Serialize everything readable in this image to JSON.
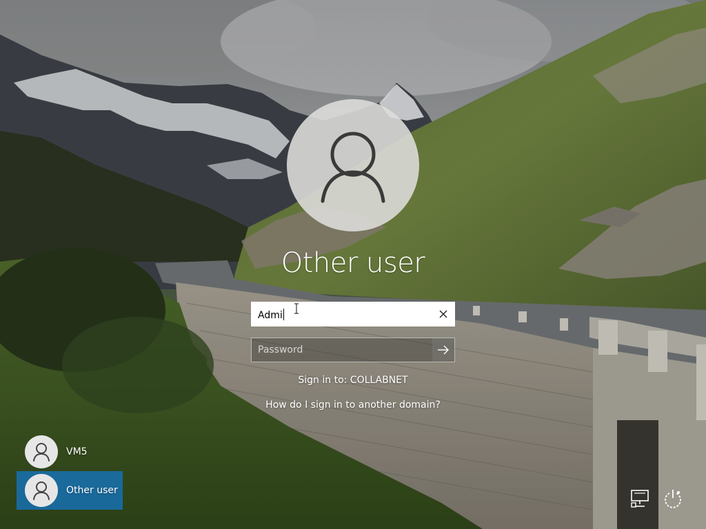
{
  "lock_screen": {
    "background": "mountain road landscape",
    "accent_color": "#1b6ea8"
  },
  "signin": {
    "user_display_name": "Other user",
    "avatar_icon": "user-silhouette-icon",
    "username_value": "Admi",
    "clear_icon": "close-icon",
    "password_placeholder": "Password",
    "submit_icon": "arrow-right-icon",
    "sign_in_to": "Sign in to: COLLABNET",
    "other_domain_link": "How do I sign in to another domain?"
  },
  "user_list": [
    {
      "name": "VM5",
      "icon": "user-silhouette-icon",
      "selected": false
    },
    {
      "name": "Other user",
      "icon": "user-silhouette-icon",
      "selected": true
    }
  ],
  "corner_icons": {
    "network": "network-icon",
    "power": "power-icon"
  }
}
